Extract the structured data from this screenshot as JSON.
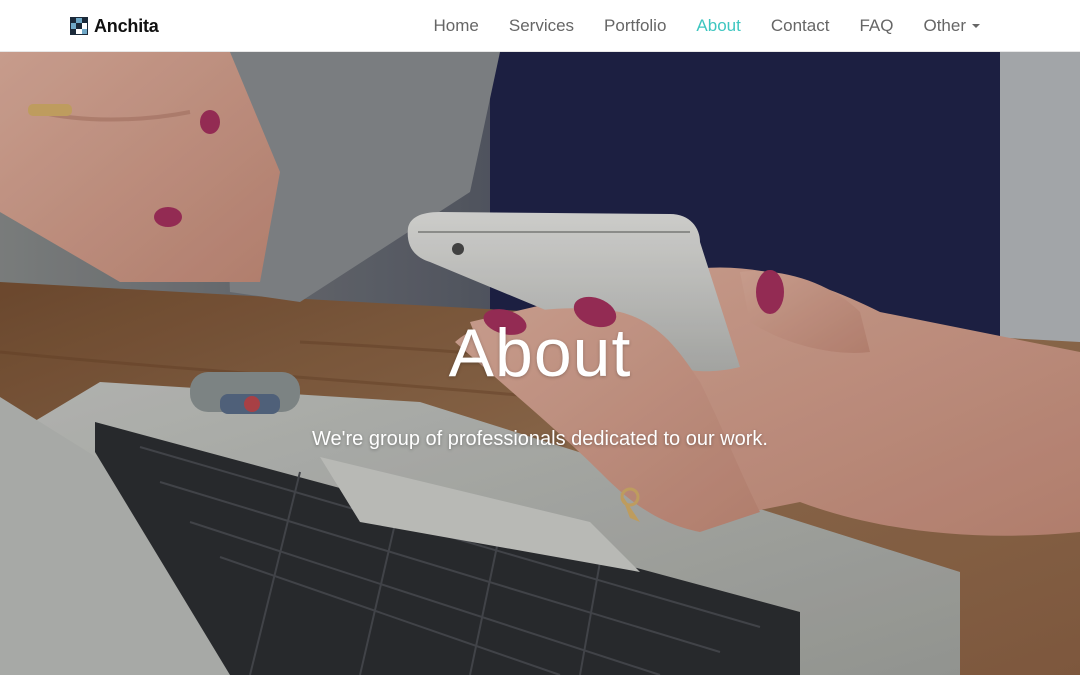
{
  "brand": {
    "name": "Anchita",
    "logo_icon": "anchita-logo-icon"
  },
  "nav": {
    "items": [
      {
        "label": "Home",
        "active": false
      },
      {
        "label": "Services",
        "active": false
      },
      {
        "label": "Portfolio",
        "active": false
      },
      {
        "label": "About",
        "active": true
      },
      {
        "label": "Contact",
        "active": false
      },
      {
        "label": "FAQ",
        "active": false
      },
      {
        "label": "Other",
        "active": false,
        "dropdown": true
      }
    ]
  },
  "hero": {
    "title": "About",
    "subtitle": "We're group of professionals dedicated to our work."
  },
  "colors": {
    "accent": "#3ec6c0",
    "nav_text": "#666666",
    "brand_text": "#111111"
  }
}
